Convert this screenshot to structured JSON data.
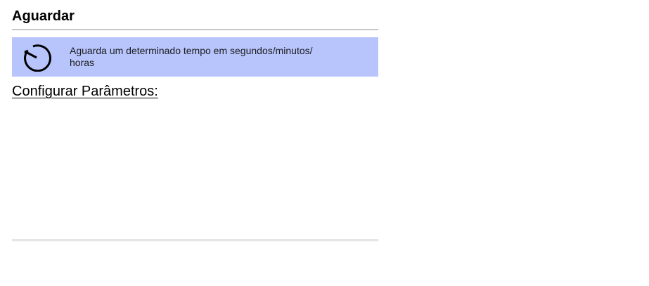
{
  "header": {
    "title": "Aguardar"
  },
  "info": {
    "icon": "timer-icon",
    "description": "Aguarda um determinado tempo em segundos/minutos/ horas",
    "background_color": "#b8c5fd"
  },
  "params": {
    "heading": "Configurar Parâmetros:"
  }
}
